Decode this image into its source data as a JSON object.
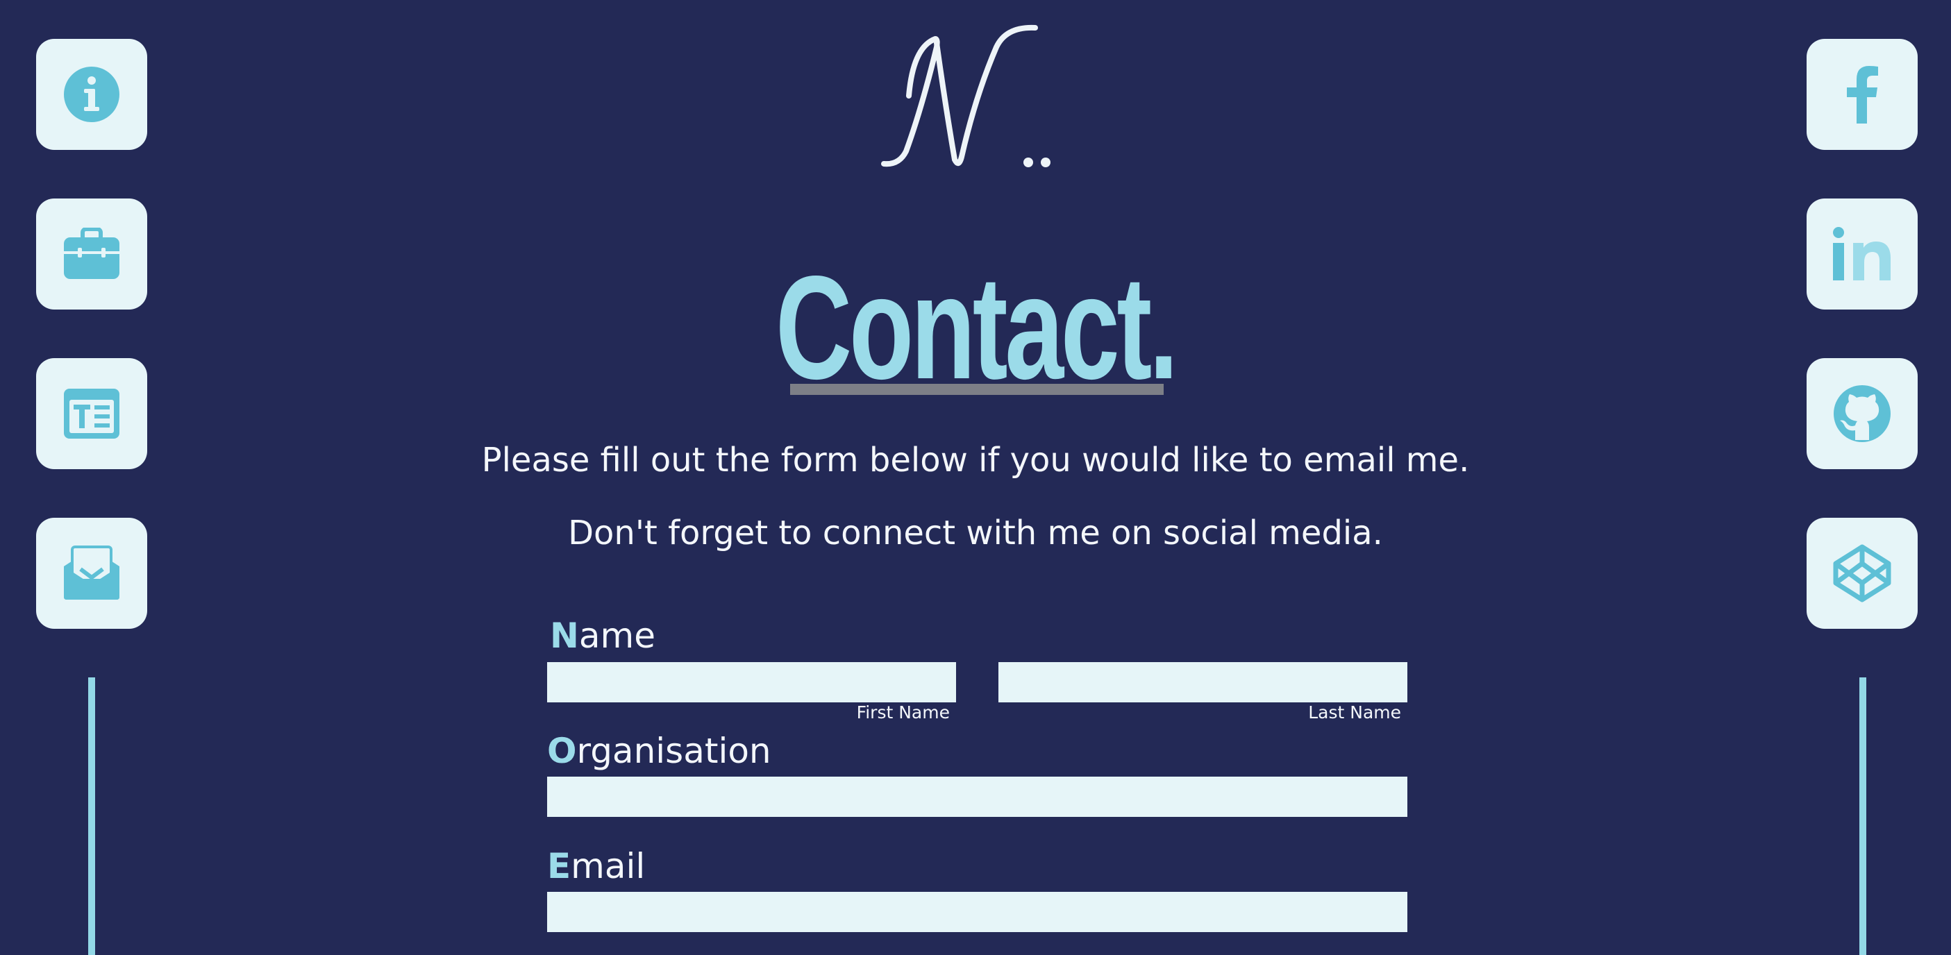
{
  "theme": {
    "background": "#232956",
    "accent": "#9bdbe9",
    "tile_background": "#e6f5f8",
    "icon_color": "#5ec0d6",
    "text": "#f4f7fb"
  },
  "nav_left": [
    {
      "icon": "info-icon"
    },
    {
      "icon": "briefcase-icon"
    },
    {
      "icon": "article-icon"
    },
    {
      "icon": "mail-open-icon"
    }
  ],
  "nav_right": [
    {
      "icon": "facebook-icon"
    },
    {
      "icon": "linkedin-icon"
    },
    {
      "icon": "github-icon"
    },
    {
      "icon": "codepen-icon"
    }
  ],
  "logo": {
    "text": "N.."
  },
  "page": {
    "title": "Contact.",
    "intro_line_1": "Please fill out the form below if you would like to email me.",
    "intro_line_2": "Don't forget to connect with me on social media."
  },
  "form": {
    "name": {
      "label_first": "N",
      "label_rest": "ame",
      "first_name_value": "",
      "last_name_value": "",
      "first_name_label": "First Name",
      "last_name_label": "Last Name"
    },
    "organisation": {
      "label_first": "O",
      "label_rest": "rganisation",
      "value": ""
    },
    "email": {
      "label_first": "E",
      "label_rest": "mail",
      "value": ""
    }
  }
}
